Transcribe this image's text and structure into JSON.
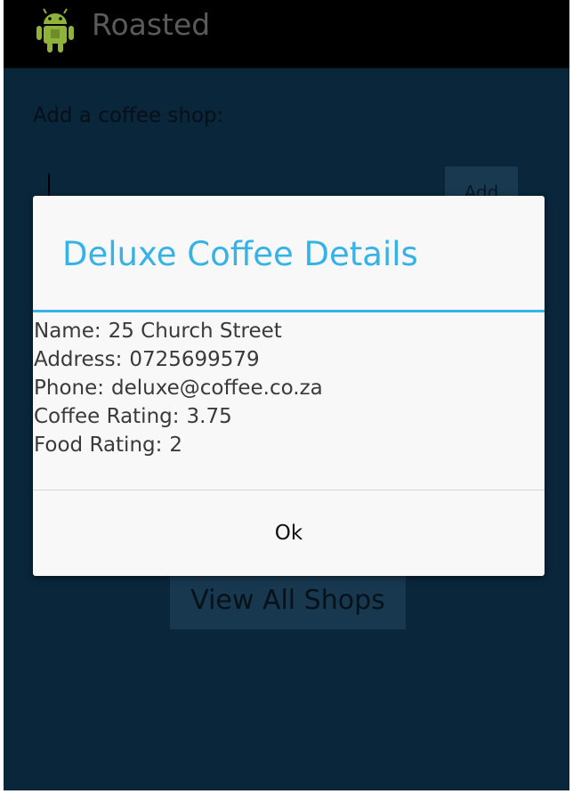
{
  "app": {
    "title": "Roasted",
    "icon": "android-icon"
  },
  "main": {
    "add_label": "Add a coffee shop:",
    "add_button_label": "Add",
    "view_all_button_label": "View All Shops"
  },
  "dialog": {
    "title": "Deluxe Coffee Details",
    "rows": [
      {
        "label": "Name:",
        "value": "25 Church Street"
      },
      {
        "label": "Address:",
        "value": "0725699579"
      },
      {
        "label": "Phone:",
        "value": "deluxe@coffee.co.za"
      },
      {
        "label": "Coffee Rating:",
        "value": "3.75"
      },
      {
        "label": "Food Rating:",
        "value": "2"
      }
    ],
    "ok_label": "Ok"
  },
  "colors": {
    "accent": "#33b5e5",
    "background": "#0a2a40",
    "action_bar": "#000000"
  }
}
